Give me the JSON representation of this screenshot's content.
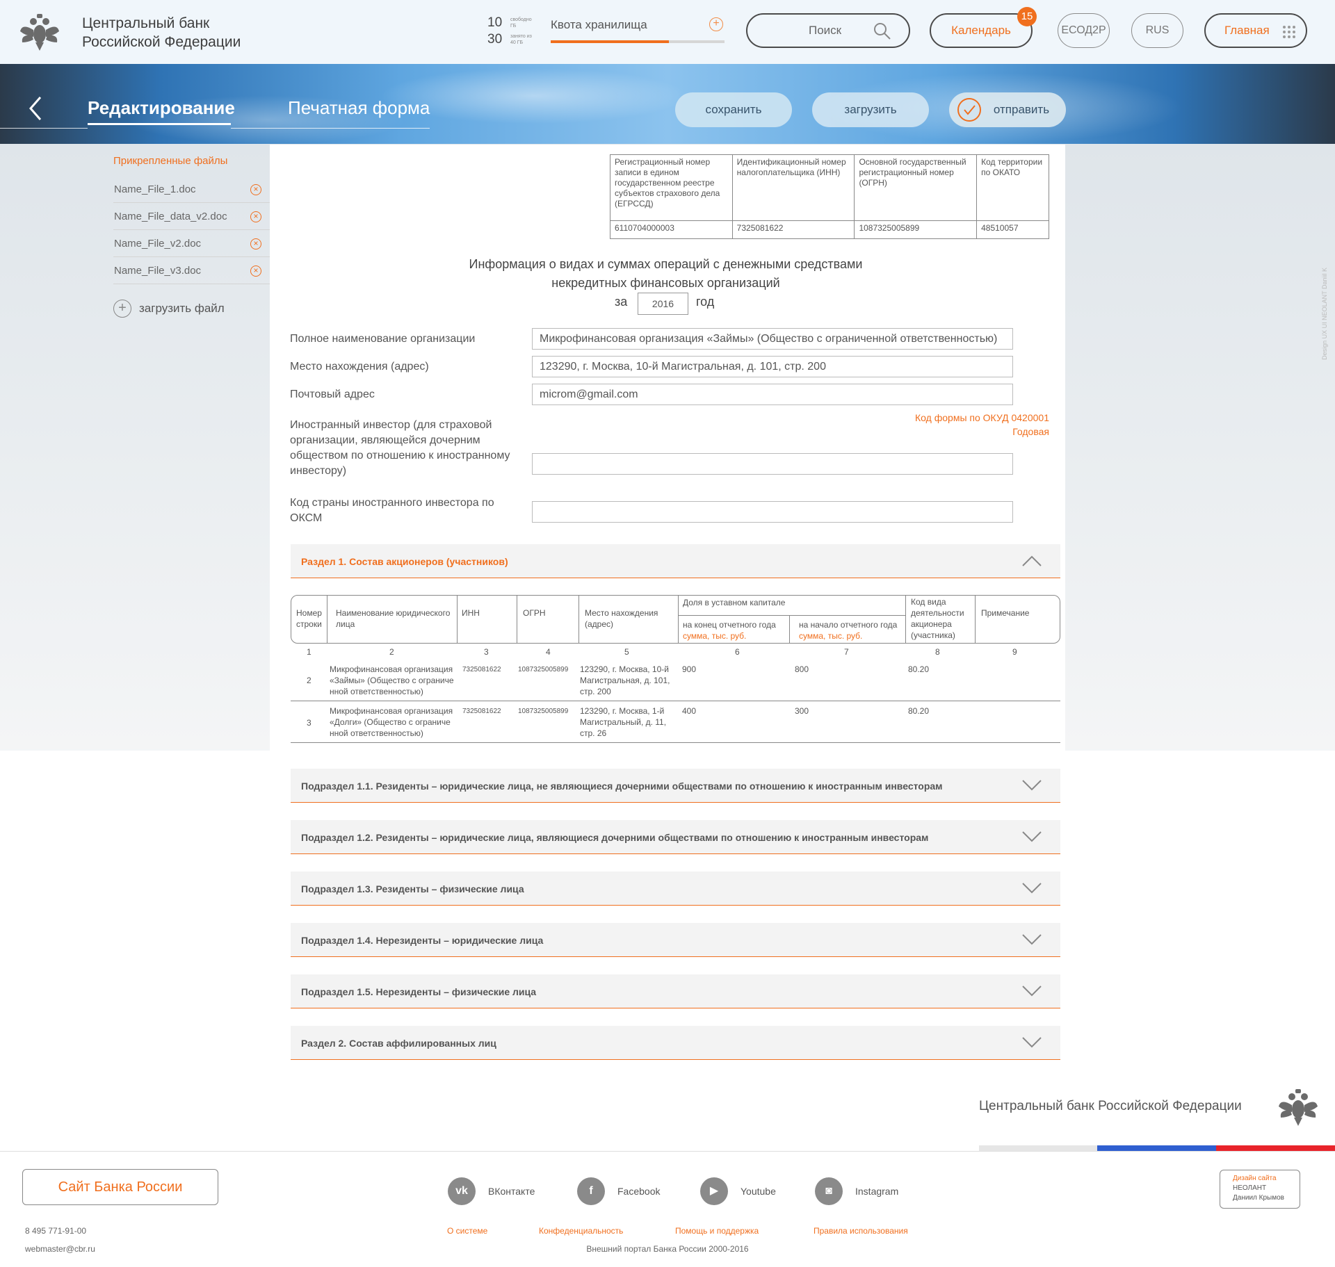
{
  "header": {
    "logo_line1": "Центральный банк",
    "logo_line2": "Российской Федерации",
    "quota": {
      "free_value": "10",
      "free_label": "свободно ГБ",
      "used_value": "30",
      "used_label": "занято из 40 ГБ",
      "title": "Квота хранилища",
      "used_fraction": 0.68
    },
    "search_placeholder": "Поиск",
    "calendar_label": "Календарь",
    "calendar_badge": "15",
    "esod_label": "ЕСОД2Р",
    "lang_label": "RUS",
    "home_label": "Главная"
  },
  "toolbar": {
    "tab_edit": "Редактирование",
    "tab_print": "Печатная форма",
    "save": "сохранить",
    "load": "загрузить",
    "send": "отправить"
  },
  "sidebar": {
    "title": "Прикрепленные файлы",
    "files": [
      "Name_File_1.doc",
      "Name_File_data_v2.doc",
      "Name_File_v2.doc",
      "Name_File_v3.doc"
    ],
    "upload": "загрузить файл"
  },
  "reg_table": {
    "headers": [
      "Регистрационный номер записи в едином государственном реестре субъектов страхового дела (ЕГРССД)",
      "Идентификационный номер налогоплательщика (ИНН)",
      "Основной государственный регистрационный номер (ОГРН)",
      "Код территории по ОКАТО"
    ],
    "values": [
      "6110704000003",
      "7325081622",
      "1087325005899",
      "48510057"
    ]
  },
  "form": {
    "title_line1": "Информация о видах и суммах операций с денежными средствами",
    "title_line2": "некредитных финансовых организаций",
    "year_prefix": "за",
    "year": "2016",
    "year_suffix": "год",
    "fields": [
      {
        "label": "Полное наименование организации",
        "value": "Микрофинансовая организация «Займы» (Общество с ограниченной ответственностью)"
      },
      {
        "label": "Место нахождения (адрес)",
        "value": "123290, г. Москва, 10-й Магистральная, д. 101, стр. 200"
      },
      {
        "label": "Почтовый адрес",
        "value": "microm@gmail.com"
      },
      {
        "label": "Иностранный инвестор (для страховой организации, являющейся дочерним обществом по отношению к иностранному инвестору)",
        "value": ""
      },
      {
        "label": "Код страны иностранного инвестора по ОКСМ",
        "value": ""
      }
    ],
    "okud_line1": "Код формы по ОКУД 0420001",
    "okud_line2": "Годовая"
  },
  "section1": {
    "title": "Раздел 1. Состав акционеров (участников)",
    "headers": {
      "num": "Номер строки",
      "name": "Наименование юридического лица",
      "inn": "ИНН",
      "ogrn": "ОГРН",
      "address": "Место нахождения (адрес)",
      "share": "Доля в уставном капитале",
      "share_end": "на конец отчетного года",
      "share_begin": "на начало отчетного года",
      "unit": "сумма, тыс. руб.",
      "activity": "Код вида деятельности акционера (участника)",
      "note": "Примечание"
    },
    "col_numbers": [
      "1",
      "2",
      "3",
      "4",
      "5",
      "6",
      "7",
      "8",
      "9"
    ],
    "rows": [
      {
        "num": "2",
        "name": "Микрофинансовая организация «Займы» (Общество с ограниче нной ответственностью)",
        "inn": "7325081622",
        "ogrn": "1087325005899",
        "address": "123290, г. Москва, 10-й Магистральная, д. 101, стр. 200",
        "end": "900",
        "begin": "800",
        "activity": "80.20",
        "note": ""
      },
      {
        "num": "3",
        "name": "Микрофинансовая организация «Долги» (Общество с ограниче нной ответственностью)",
        "inn": "7325081622",
        "ogrn": "1087325005899",
        "address": "123290, г. Москва, 1-й Магистральный, д. 11, стр. 26",
        "end": "400",
        "begin": "300",
        "activity": "80.20",
        "note": ""
      }
    ]
  },
  "subsections": [
    "Подраздел 1.1. Резиденты – юридические лица, не являющиеся дочерними обществами по отношению к иностранным инвесторам",
    "Подраздел 1.2. Резиденты – юридические лица, являющиеся дочерними обществами по отношению к иностранным инвесторам",
    "Подраздел 1.3. Резиденты – физические лица",
    "Подраздел 1.4. Нерезиденты – юридические лица",
    "Подраздел 1.5. Нерезиденты – физические лица",
    "Раздел 2. Состав аффилированных лиц"
  ],
  "footer": {
    "bank_name": "Центральный банк Российской Федерации",
    "site_button": "Сайт Банка России",
    "phone": "8 495 771-91-00",
    "email": "webmaster@cbr.ru",
    "social": [
      {
        "icon": "vk-icon",
        "label": "ВКонтакте",
        "glyph": "vk"
      },
      {
        "icon": "facebook-icon",
        "label": "Facebook",
        "glyph": "f"
      },
      {
        "icon": "youtube-icon",
        "label": "Youtube",
        "glyph": "▶"
      },
      {
        "icon": "instagram-icon",
        "label": "Instagram",
        "glyph": "◙"
      }
    ],
    "links": [
      "О системе",
      "Конфеденциальность",
      "Помощь и поддержка",
      "Правила использования"
    ],
    "copyright": "Внешний портал Банка России 2000-2016",
    "design_line1": "Дизайн сайта",
    "design_line2": "НЕОЛАНТ",
    "design_line3": "Даниил Крымов",
    "vertical_credit": "Design UX UI NEOLANT Daniil K"
  },
  "colors": {
    "accent": "#f06f1e",
    "blue": "#2f5fd0",
    "red": "#e8232a"
  }
}
